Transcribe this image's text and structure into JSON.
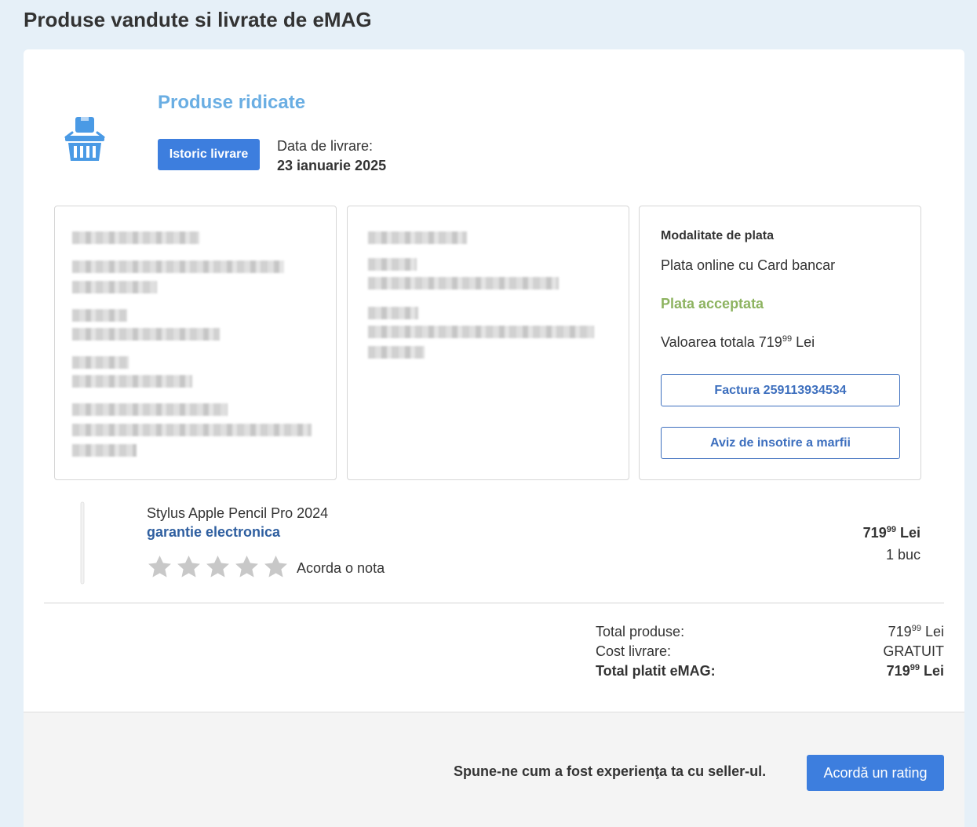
{
  "page": {
    "title": "Produse vandute si livrate de eMAG"
  },
  "order": {
    "status": "Produse ridicate",
    "history_button": "Istoric livrare",
    "delivery_label": "Data de livrare:",
    "delivery_date": "23 ianuarie 2025",
    "icon": "shopping-basket-icon"
  },
  "payment": {
    "title": "Modalitate de plata",
    "method": "Plata online cu Card bancar",
    "status": "Plata acceptata",
    "total_label": "Valoarea totala",
    "total_main": "719",
    "total_decimals": "99",
    "total_currency": "Lei",
    "invoice_button": "Factura 259113934534",
    "notice_button": "Aviz de insotire a marfii"
  },
  "product": {
    "name": "Stylus Apple Pencil Pro 2024",
    "warranty": "garantie electronica",
    "rating_label": "Acorda o nota",
    "stars": 5,
    "price_main": "719",
    "price_decimals": "99",
    "price_currency": "Lei",
    "quantity": "1 buc"
  },
  "summary": {
    "products_label": "Total produse:",
    "products_main": "719",
    "products_decimals": "99",
    "products_currency": "Lei",
    "shipping_label": "Cost livrare:",
    "shipping_value": "GRATUIT",
    "total_label": "Total platit eMAG:",
    "total_main": "719",
    "total_decimals": "99",
    "total_currency": "Lei"
  },
  "footer": {
    "prompt": "Spune-ne cum a fost experienţa ta cu seller-ul.",
    "rating_button": "Acordă un rating"
  },
  "colors": {
    "accent": "#3d7ede",
    "status_title": "#6aaee3",
    "payment_ok": "#8db360",
    "link": "#2f5fa0",
    "page_bg": "#e6f0f8"
  }
}
